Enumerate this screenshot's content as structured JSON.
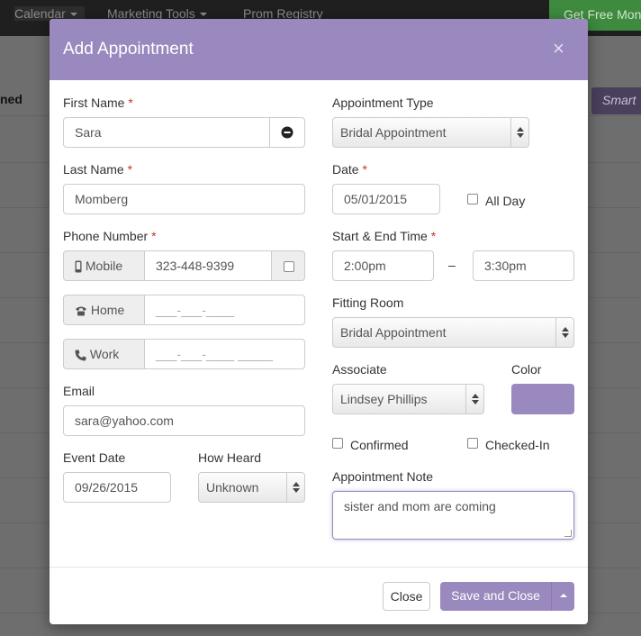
{
  "background": {
    "nav": {
      "calendar": "Calendar",
      "marketing": "Marketing Tools",
      "prom": "Prom Registry",
      "get_free": "Get Free Mon"
    },
    "column_header": "ned",
    "smart_button": "Smart"
  },
  "modal": {
    "title": "Add Appointment",
    "close_symbol": "×",
    "required_mark": "*",
    "first_name": {
      "label": "First Name",
      "value": "Sara"
    },
    "last_name": {
      "label": "Last Name",
      "value": "Momberg"
    },
    "phone": {
      "label": "Phone Number",
      "mobile": {
        "label": "Mobile",
        "value": "323-448-9399"
      },
      "home": {
        "label": "Home",
        "placeholder": "___-___-____"
      },
      "work": {
        "label": "Work",
        "placeholder": "___-___-____ _____"
      }
    },
    "email": {
      "label": "Email",
      "value": "sara@yahoo.com"
    },
    "event_date": {
      "label": "Event Date",
      "value": "09/26/2015"
    },
    "how_heard": {
      "label": "How Heard",
      "value": "Unknown"
    },
    "appointment_type": {
      "label": "Appointment Type",
      "value": "Bridal Appointment"
    },
    "date": {
      "label": "Date",
      "value": "05/01/2015"
    },
    "all_day": {
      "label": "All Day",
      "checked": false
    },
    "time": {
      "label": "Start & End Time",
      "start": "2:00pm",
      "separator": "–",
      "end": "3:30pm"
    },
    "fitting_room": {
      "label": "Fitting Room",
      "value": "Bridal Appointment"
    },
    "associate": {
      "label": "Associate",
      "value": "Lindsey Phillips"
    },
    "color": {
      "label": "Color",
      "value": "#9a89be"
    },
    "confirmed": {
      "label": "Confirmed",
      "checked": false
    },
    "checked_in": {
      "label": "Checked-In",
      "checked": false
    },
    "note": {
      "label": "Appointment Note",
      "value": "sister and mom are coming"
    },
    "buttons": {
      "close": "Close",
      "save_close": "Save and Close"
    }
  }
}
